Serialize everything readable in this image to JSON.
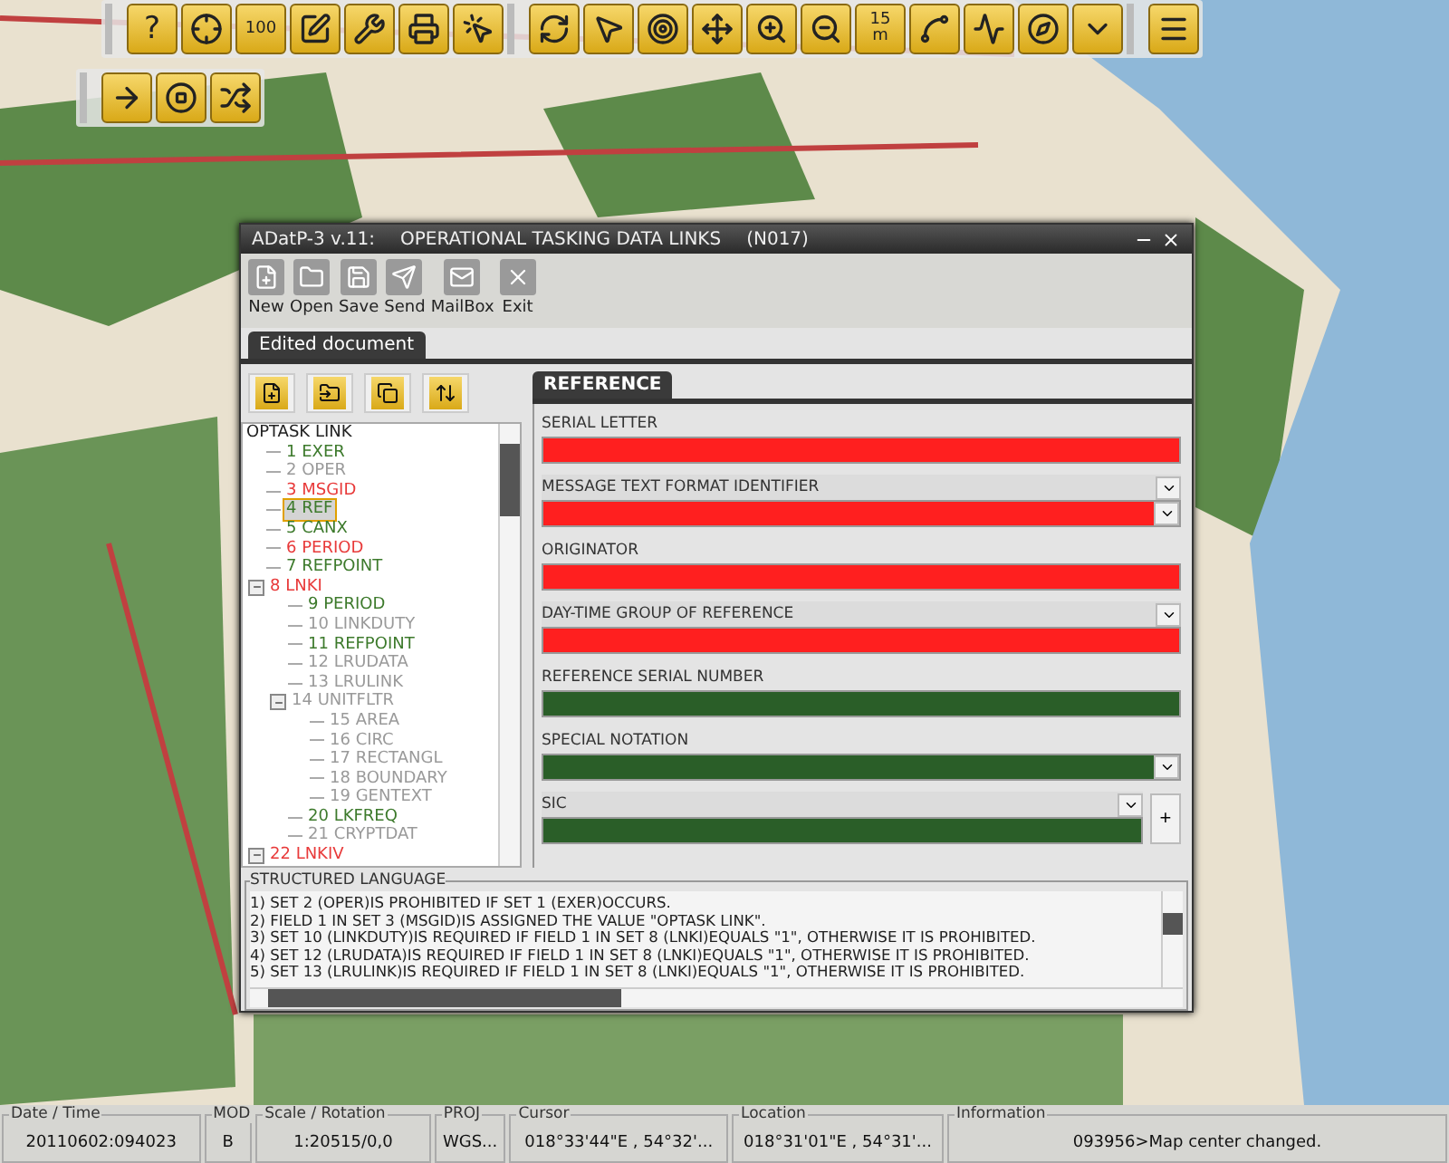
{
  "map_toolbar": {
    "groups": [
      [
        {
          "kind": "help",
          "label": "?"
        },
        {
          "kind": "crosshair"
        },
        {
          "kind": "scale",
          "label": "100"
        },
        {
          "kind": "edit"
        },
        {
          "kind": "tools"
        },
        {
          "kind": "print"
        },
        {
          "kind": "select"
        }
      ],
      [
        {
          "kind": "refresh"
        },
        {
          "kind": "pointer"
        },
        {
          "kind": "target"
        },
        {
          "kind": "move"
        },
        {
          "kind": "zoom_in"
        },
        {
          "kind": "zoom_out"
        },
        {
          "kind": "scale",
          "label": "15",
          "unit": "m"
        },
        {
          "kind": "curve"
        },
        {
          "kind": "profile"
        },
        {
          "kind": "compass"
        },
        {
          "kind": "down"
        }
      ],
      [
        {
          "kind": "menu"
        }
      ]
    ],
    "second_row": [
      {
        "kind": "arrow"
      },
      {
        "kind": "stop"
      },
      {
        "kind": "shuffle"
      }
    ]
  },
  "window": {
    "app": "ADatP-3 v.11:",
    "title": "OPERATIONAL TASKING DATA LINKS",
    "code": "(N017)",
    "toolbar": [
      {
        "kind": "new",
        "label": "New"
      },
      {
        "kind": "open",
        "label": "Open"
      },
      {
        "kind": "save",
        "label": "Save"
      },
      {
        "kind": "send",
        "label": "Send"
      },
      {
        "kind": "mail",
        "label": "MailBox"
      },
      {
        "kind": "exit",
        "label": "Exit"
      }
    ],
    "tab": "Edited document",
    "tree_buttons": [
      {
        "kind": "add"
      },
      {
        "kind": "insert"
      },
      {
        "kind": "copy"
      },
      {
        "kind": "updown"
      }
    ],
    "tree": {
      "label": "OPTASK LINK",
      "children": [
        {
          "label": "1 EXER",
          "color": "#3d7a2c",
          "selected": false
        },
        {
          "label": "2 OPER",
          "color": "#9a9a9a",
          "selected": false
        },
        {
          "label": "3 MSGID",
          "color": "#e83a3a",
          "selected": false
        },
        {
          "label": "4 REF",
          "color": "#3d7a2c",
          "selected": true
        },
        {
          "label": "5 CANX",
          "color": "#3d7a2c",
          "selected": false
        },
        {
          "label": "6 PERIOD",
          "color": "#e83a3a",
          "selected": false
        },
        {
          "label": "7 REFPOINT",
          "color": "#3d7a2c",
          "selected": false
        },
        {
          "label": "8 LNKI",
          "color": "#e83a3a",
          "selected": false,
          "expanded": true,
          "children": [
            {
              "label": "9 PERIOD",
              "color": "#3d7a2c",
              "selected": false
            },
            {
              "label": "10 LINKDUTY",
              "color": "#9a9a9a",
              "selected": false
            },
            {
              "label": "11 REFPOINT",
              "color": "#3d7a2c",
              "selected": false
            },
            {
              "label": "12 LRUDATA",
              "color": "#9a9a9a",
              "selected": false
            },
            {
              "label": "13 LRULINK",
              "color": "#9a9a9a",
              "selected": false
            },
            {
              "label": "14 UNITFLTR",
              "color": "#9a9a9a",
              "selected": false,
              "expanded": true,
              "children": [
                {
                  "label": "15 AREA",
                  "color": "#9a9a9a",
                  "selected": false
                },
                {
                  "label": "16 CIRC",
                  "color": "#9a9a9a",
                  "selected": false
                },
                {
                  "label": "17 RECTANGL",
                  "color": "#9a9a9a",
                  "selected": false
                },
                {
                  "label": "18 BOUNDARY",
                  "color": "#9a9a9a",
                  "selected": false
                },
                {
                  "label": "19 GENTEXT",
                  "color": "#9a9a9a",
                  "selected": false
                }
              ]
            },
            {
              "label": "20 LKFREQ",
              "color": "#3d7a2c",
              "selected": false
            },
            {
              "label": "21 CRYPTDAT",
              "color": "#9a9a9a",
              "selected": false
            }
          ]
        },
        {
          "label": "22 LNKIV",
          "color": "#e83a3a",
          "selected": false,
          "expanded": true
        }
      ]
    },
    "form_tab": "REFERENCE",
    "fields": [
      {
        "label": "SERIAL LETTER",
        "color": "#ff1f1f",
        "label_menu": false,
        "value_menu": false,
        "add_button": false
      },
      {
        "label": "MESSAGE TEXT FORMAT IDENTIFIER",
        "color": "#ff1f1f",
        "label_menu": true,
        "value_menu": true,
        "add_button": false
      },
      {
        "label": "ORIGINATOR",
        "color": "#ff1f1f",
        "label_menu": false,
        "value_menu": false,
        "add_button": false
      },
      {
        "label": "DAY-TIME GROUP OF REFERENCE",
        "color": "#ff1f1f",
        "label_menu": true,
        "value_menu": false,
        "add_button": false
      },
      {
        "label": "REFERENCE SERIAL NUMBER",
        "color": "#2a5e28",
        "label_menu": false,
        "value_menu": false,
        "add_button": false
      },
      {
        "label": "SPECIAL NOTATION",
        "color": "#2a5e28",
        "label_menu": false,
        "value_menu": true,
        "add_button": false
      },
      {
        "label": "SIC",
        "color": "#2a5e28",
        "label_menu": true,
        "value_menu": false,
        "add_button": true,
        "add_label": "+"
      }
    ],
    "structured_language": {
      "title": "STRUCTURED LANGUAGE",
      "lines": [
        "1) SET 2 (OPER)IS PROHIBITED IF SET 1 (EXER)OCCURS.",
        "2) FIELD 1 IN SET 3 (MSGID)IS ASSIGNED THE VALUE \"OPTASK LINK\".",
        "3) SET 10 (LINKDUTY)IS REQUIRED IF FIELD 1 IN SET 8 (LNKI)EQUALS \"1\", OTHERWISE IT IS PROHIBITED.",
        "4) SET 12 (LRUDATA)IS REQUIRED IF FIELD 1 IN SET 8 (LNKI)EQUALS \"1\", OTHERWISE IT IS PROHIBITED.",
        "5) SET 13 (LRULINK)IS REQUIRED IF FIELD 1 IN SET 8 (LNKI)EQUALS \"1\", OTHERWISE IT IS PROHIBITED."
      ]
    }
  },
  "status_bar": [
    {
      "label": "Date / Time",
      "value": "20110602:094023"
    },
    {
      "label": "MOD",
      "value": "B"
    },
    {
      "label": "Scale / Rotation",
      "value": "1:20515/0,0"
    },
    {
      "label": "PROJ",
      "value": "WGS..."
    },
    {
      "label": "Cursor",
      "value": "018°33'44\"E , 54°32'..."
    },
    {
      "label": "Location",
      "value": "018°31'01\"E , 54°31'..."
    },
    {
      "label": "Information",
      "value": "093956>Map center changed."
    }
  ]
}
